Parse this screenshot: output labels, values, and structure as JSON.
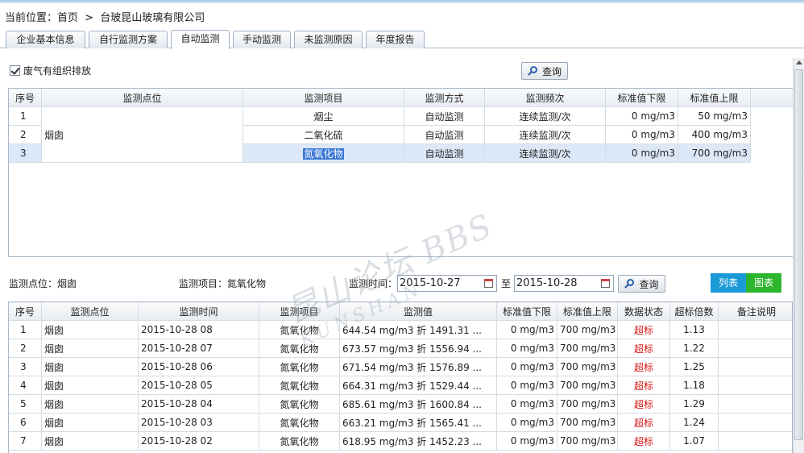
{
  "breadcrumb": {
    "label": "当前位置：",
    "home": "首页",
    "separator": ">",
    "company": "台玻昆山玻璃有限公司"
  },
  "tabs": [
    "企业基本信息",
    "自行监测方案",
    "自动监测",
    "手动监测",
    "未监测原因",
    "年度报告"
  ],
  "active_tab": "自动监测",
  "checkbox_label": "废气有组织排放",
  "query_label": "查询",
  "grid1": {
    "headers": [
      "序号",
      "监测点位",
      "监测项目",
      "监测方式",
      "监测频次",
      "标准值下限",
      "标准值上限"
    ],
    "point": "烟囱",
    "rows": [
      {
        "no": "1",
        "item": "烟尘",
        "method": "自动监测",
        "freq": "连续监测/次",
        "low": "0 mg/m3",
        "high": "50 mg/m3"
      },
      {
        "no": "2",
        "item": "二氧化硫",
        "method": "自动监测",
        "freq": "连续监测/次",
        "low": "0 mg/m3",
        "high": "400 mg/m3"
      },
      {
        "no": "3",
        "item": "氮氧化物",
        "method": "自动监测",
        "freq": "连续监测/次",
        "low": "0 mg/m3",
        "high": "700 mg/m3"
      }
    ]
  },
  "filter": {
    "point_label": "监测点位：烟囱",
    "item_label": "监测项目：氮氧化物",
    "time_label": "监测时间：",
    "start_date": "2015-10-27",
    "to_label": "至",
    "end_date": "2015-10-28",
    "view_list": "列表",
    "view_chart": "图表"
  },
  "colors": {
    "list_button": "#1a9bd7",
    "chart_button": "#2db52d",
    "exceed_text": "#d71414"
  },
  "grid2": {
    "headers": [
      "序号",
      "监测点位",
      "监测时间",
      "监测项目",
      "监测值",
      "标准值下限",
      "标准值上限",
      "数据状态",
      "超标倍数",
      "备注说明"
    ],
    "rows": [
      {
        "no": "1",
        "point": "烟囱",
        "time": "2015-10-28 08",
        "item": "氮氧化物",
        "value": "644.54  mg/m3  折  1491.31  ...",
        "low": "0 mg/m3",
        "high": "700 mg/m3",
        "status": "超标",
        "ratio": "1.13"
      },
      {
        "no": "2",
        "point": "烟囱",
        "time": "2015-10-28 07",
        "item": "氮氧化物",
        "value": "673.57  mg/m3  折  1556.94  ...",
        "low": "0 mg/m3",
        "high": "700 mg/m3",
        "status": "超标",
        "ratio": "1.22"
      },
      {
        "no": "3",
        "point": "烟囱",
        "time": "2015-10-28 06",
        "item": "氮氧化物",
        "value": "671.54  mg/m3  折  1576.89  ...",
        "low": "0 mg/m3",
        "high": "700 mg/m3",
        "status": "超标",
        "ratio": "1.25"
      },
      {
        "no": "4",
        "point": "烟囱",
        "time": "2015-10-28 05",
        "item": "氮氧化物",
        "value": "664.31  mg/m3  折  1529.44  ...",
        "low": "0 mg/m3",
        "high": "700 mg/m3",
        "status": "超标",
        "ratio": "1.18"
      },
      {
        "no": "5",
        "point": "烟囱",
        "time": "2015-10-28 04",
        "item": "氮氧化物",
        "value": "685.61  mg/m3  折  1600.84  ...",
        "low": "0 mg/m3",
        "high": "700 mg/m3",
        "status": "超标",
        "ratio": "1.29"
      },
      {
        "no": "6",
        "point": "烟囱",
        "time": "2015-10-28 03",
        "item": "氮氧化物",
        "value": "663.21  mg/m3  折  1565.41  ...",
        "low": "0 mg/m3",
        "high": "700 mg/m3",
        "status": "超标",
        "ratio": "1.24"
      },
      {
        "no": "7",
        "point": "烟囱",
        "time": "2015-10-28 02",
        "item": "氮氧化物",
        "value": "618.95  mg/m3  折  1452.23  ...",
        "low": "0 mg/m3",
        "high": "700 mg/m3",
        "status": "超标",
        "ratio": "1.07"
      }
    ]
  },
  "watermark": {
    "line1": "昆山论坛 BBS",
    "line2": "KUNSHAN"
  }
}
